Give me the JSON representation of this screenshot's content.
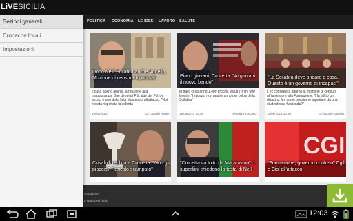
{
  "app": {
    "logo_part1": "LiVE",
    "logo_part2": "SICILIA"
  },
  "tabs": [
    "POLITICA",
    "ECONOMIA",
    "LE IDEE",
    "LAVORO",
    "SALUTE"
  ],
  "drawer": {
    "items": [
      {
        "label": "Sezioni generali",
        "active": true
      },
      {
        "label": "Cronache locali",
        "active": false
      },
      {
        "label": "Impostazioni",
        "active": false
      }
    ]
  },
  "cards": [
    {
      "title": "Dopo Nelli Scilabra anche Agnello. Mozione di censura bipartisan",
      "snippet": "Il caso aperto allarga la mozione alla maggioranza. Due deputati Pdr, due del Pd, tre tecnici e uno della lista Musumeci all'attacco. \"Noi è stata rispettata la volontà",
      "date": "19/09/2014",
      "author": "Di Claudio Reale"
    },
    {
      "title": "Piano giovani, Crocetta: \"Ai giovani il nuovo bando\"",
      "snippet": "In ballo ci saranno 1.400 tirocini. Valuti i primi 500 tirocini. \"I ragazzi non pagheranno per colpa della Scilabra\"",
      "date": "19/09/2014 14:58",
      "author": "Di Salvo Toscano"
    },
    {
      "title": "\"La Scilabra deve andare a casa. Questo è un governo di incapaci\"",
      "snippet": "L'ex consigliera attorno la mozione di censura all'assessore alla Formazione: \"Ha fallito un disastro. Ma come possiamo aspettare da una studentessa fuorionda?\"",
      "date": "19/09/2014 14:56",
      "author": "Di Antonio Sabella"
    },
    {
      "title": "Crisafulli replica a Crocetta: \"Non gli piaccio? Pericolo scampato\"",
      "snippet": "",
      "date": "",
      "author": ""
    },
    {
      "title": "\"Crocetta va tolto da Maranzano\": I superliini chiedono la testa di Nelli",
      "snippet": "",
      "date": "",
      "author": ""
    },
    {
      "title": "\"Formazione, governo confuso\" Cgil e Cisl all'attacco",
      "snippet": "",
      "date": "",
      "author": ""
    }
  ],
  "ad": {
    "line1": "Google.ne",
    "line2": "è stato così facile"
  },
  "status": {
    "time": "12:03"
  },
  "colors": {
    "accent": "#8dbb35",
    "tab_active": "#4d90fe"
  }
}
